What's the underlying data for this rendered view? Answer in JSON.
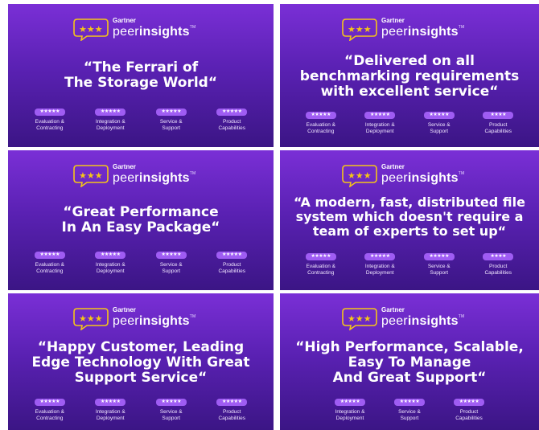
{
  "brand": {
    "small": "Gartner",
    "big_thin": "peer",
    "big_bold": "insights",
    "tm": "TM"
  },
  "colors": {
    "card_top": "#7a2fd6",
    "card_bottom": "#3b1585",
    "pill": "#9f5cf3",
    "star": "#f5c518"
  },
  "cards": [
    {
      "quote_lines": [
        "“The Ferrari of",
        "The Storage World“"
      ],
      "ratings": [
        {
          "stars": "★★★★★",
          "label_1": "Evaluation &",
          "label_2": "Contracting"
        },
        {
          "stars": "★★★★★",
          "label_1": "Integration &",
          "label_2": "Deployment"
        },
        {
          "stars": "★★★★★",
          "label_1": "Service &",
          "label_2": "Support"
        },
        {
          "stars": "★★★★★",
          "label_1": "Product",
          "label_2": "Capabilities"
        }
      ]
    },
    {
      "quote_lines": [
        "“Delivered on all",
        "benchmarking requirements",
        "with excellent service“"
      ],
      "ratings": [
        {
          "stars": "★★★★★",
          "label_1": "Evaluation &",
          "label_2": "Contracting"
        },
        {
          "stars": "★★★★★",
          "label_1": "Integration &",
          "label_2": "Deployment"
        },
        {
          "stars": "★★★★★",
          "label_1": "Service &",
          "label_2": "Support"
        },
        {
          "stars": "★★★★",
          "label_1": "Product",
          "label_2": "Capabilities"
        }
      ]
    },
    {
      "quote_lines": [
        "“Great Performance",
        "In An Easy Package“"
      ],
      "ratings": [
        {
          "stars": "★★★★★",
          "label_1": "Evaluation &",
          "label_2": "Contracting"
        },
        {
          "stars": "★★★★★",
          "label_1": "Integration &",
          "label_2": "Deployment"
        },
        {
          "stars": "★★★★★",
          "label_1": "Service &",
          "label_2": "Support"
        },
        {
          "stars": "★★★★★",
          "label_1": "Product",
          "label_2": "Capabilities"
        }
      ]
    },
    {
      "quote_lines": [
        "“A modern, fast, distributed file",
        "system which doesn't require a",
        "team of experts to set up“"
      ],
      "ratings": [
        {
          "stars": "★★★★★",
          "label_1": "Evaluation &",
          "label_2": "Contracting"
        },
        {
          "stars": "★★★★★",
          "label_1": "Integration &",
          "label_2": "Deployment"
        },
        {
          "stars": "★★★★★",
          "label_1": "Service &",
          "label_2": "Support"
        },
        {
          "stars": "★★★★",
          "label_1": "Product",
          "label_2": "Capabilities"
        }
      ]
    },
    {
      "quote_lines": [
        "“Happy Customer, Leading",
        "Edge Technology With Great",
        "Support Service“"
      ],
      "ratings": [
        {
          "stars": "★★★★★",
          "label_1": "Evaluation &",
          "label_2": "Contracting"
        },
        {
          "stars": "★★★★★",
          "label_1": "Integration &",
          "label_2": "Deployment"
        },
        {
          "stars": "★★★★★",
          "label_1": "Service &",
          "label_2": "Support"
        },
        {
          "stars": "★★★★★",
          "label_1": "Product",
          "label_2": "Capabilities"
        }
      ]
    },
    {
      "quote_lines": [
        "“High Performance, Scalable,",
        "Easy To Manage",
        "And Great Support“"
      ],
      "ratings": [
        {
          "stars": "★★★★★",
          "label_1": "Integration &",
          "label_2": "Deployment"
        },
        {
          "stars": "★★★★★",
          "label_1": "Service &",
          "label_2": "Support"
        },
        {
          "stars": "★★★★★",
          "label_1": "Product",
          "label_2": "Capabilities"
        }
      ]
    }
  ]
}
